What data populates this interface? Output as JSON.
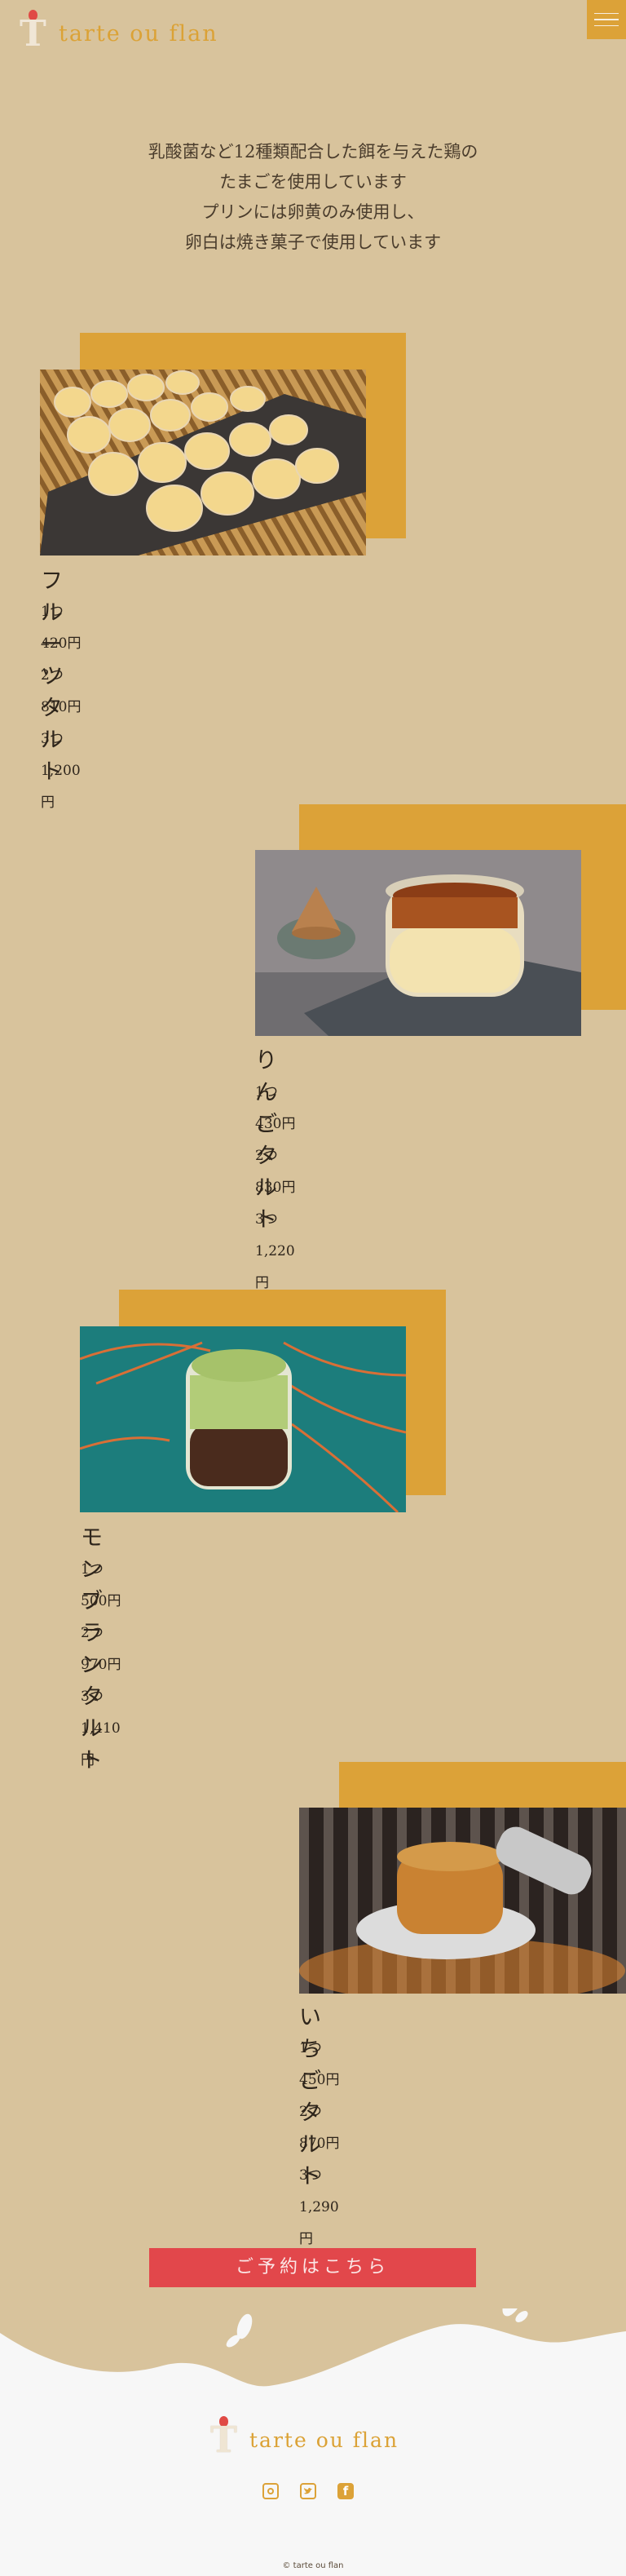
{
  "header": {
    "brand": "tarte ou flan",
    "menu_label": "menu-icon"
  },
  "intro": {
    "line1": "乳酸菌など12種類配合した餌を与えた鶏の",
    "line2": "たまごを使用しています",
    "line3": "プリンには卵黄のみ使用し、",
    "line4": "卵白は焼き菓子で使用しています"
  },
  "products": [
    {
      "name": "フルーツタルト",
      "prices": [
        {
          "qty": "1つ",
          "price": "420円"
        },
        {
          "qty": "2つ",
          "price": "810円"
        },
        {
          "qty": "3つ",
          "price": "1,200円"
        }
      ]
    },
    {
      "name": "りんごタルト",
      "prices": [
        {
          "qty": "1つ",
          "price": "430円"
        },
        {
          "qty": "2つ",
          "price": "830円"
        },
        {
          "qty": "3つ",
          "price": "1,220円"
        }
      ]
    },
    {
      "name": "モンブランタルト",
      "prices": [
        {
          "qty": "1つ",
          "price": "500円"
        },
        {
          "qty": "2つ",
          "price": "970円"
        },
        {
          "qty": "3つ",
          "price": "1,410円"
        }
      ]
    },
    {
      "name": "いちごタルト",
      "prices": [
        {
          "qty": "1つ",
          "price": "450円"
        },
        {
          "qty": "2つ",
          "price": "870円"
        },
        {
          "qty": "3つ",
          "price": "1,290円"
        }
      ]
    }
  ],
  "reserve": {
    "label": "ご予約はこちら"
  },
  "footer": {
    "brand": "tarte ou flan",
    "social": [
      "instagram-icon",
      "twitter-icon",
      "facebook-icon"
    ],
    "copyright": "© tarte ou flan"
  },
  "colors": {
    "background": "#d8c39c",
    "accent": "#dca238",
    "reserve_button": "#e2474b",
    "footer": "#f7f7f7"
  }
}
